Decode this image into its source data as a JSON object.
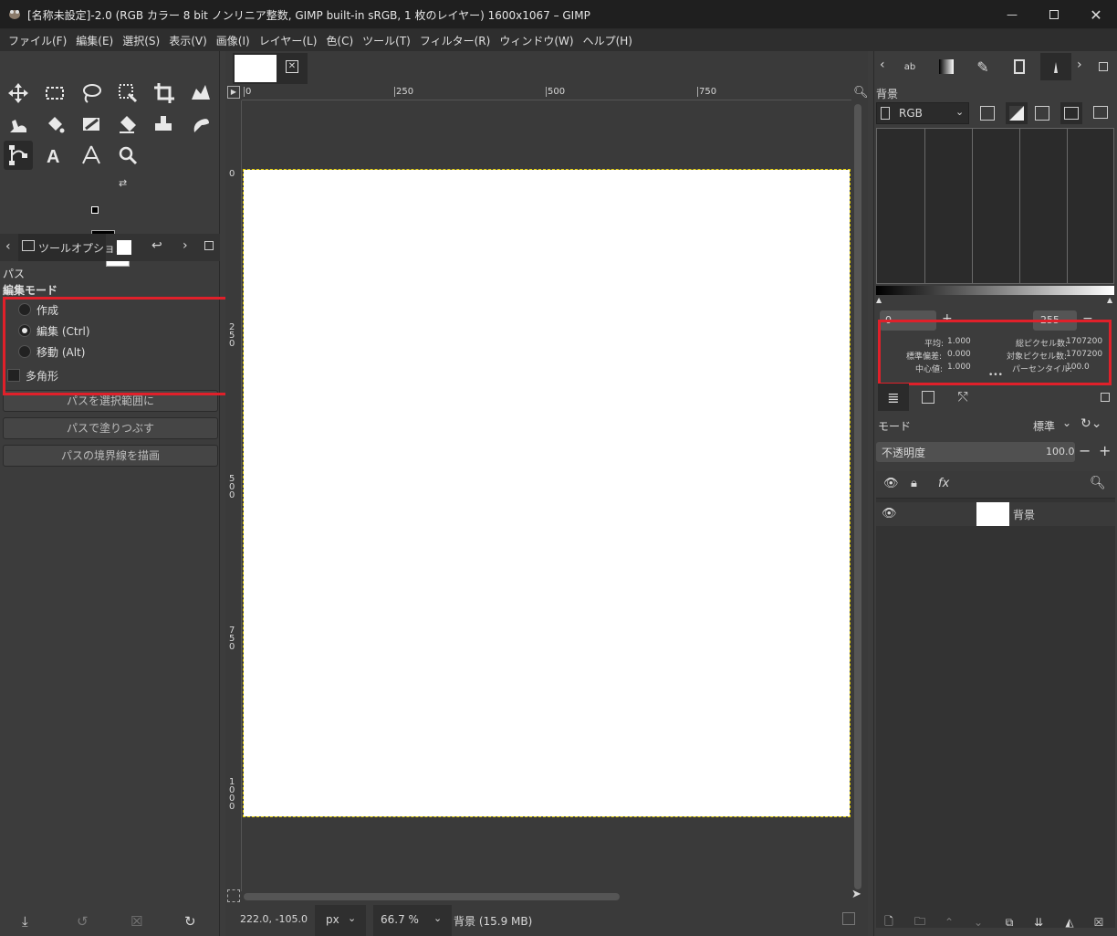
{
  "window": {
    "title": "[名称未設定]-2.0 (RGB カラー 8 bit ノンリニア整数, GIMP built-in sRGB, 1 枚のレイヤー) 1600x1067 – GIMP"
  },
  "menu": [
    "ファイル(F)",
    "編集(E)",
    "選択(S)",
    "表示(V)",
    "画像(I)",
    "レイヤー(L)",
    "色(C)",
    "ツール(T)",
    "フィルター(R)",
    "ウィンドウ(W)",
    "ヘルプ(H)"
  ],
  "tool_options": {
    "tab_label": "ツールオプション",
    "tool_name": "パス",
    "edit_mode_label": "編集モード",
    "modes": [
      "作成",
      "編集 (Ctrl)",
      "移動 (Alt)"
    ],
    "selected_mode": "編集 (Ctrl)",
    "polygon_label": "多角形",
    "buttons": [
      "パスを選択範囲に",
      "パスで塗りつぶす",
      "パスの境界線を描画"
    ]
  },
  "ruler": {
    "h_ticks": [
      "0",
      "250",
      "500",
      "750"
    ],
    "v_ticks": [
      "0",
      "2\n5\n0",
      "5\n0\n0",
      "7\n5\n0",
      "1\n0\n0\n0"
    ]
  },
  "status": {
    "coords": "222.0, -105.0",
    "unit": "px",
    "zoom": "66.7 %",
    "info": "背景 (15.9 MB)"
  },
  "histogram": {
    "layer_name": "背景",
    "channel": "RGB",
    "range_low": "0",
    "range_high": "255",
    "stats": {
      "mean_label": "平均:",
      "mean": "1.000",
      "std_label": "標準偏差:",
      "std": "0.000",
      "median_label": "中心値:",
      "median": "1.000",
      "pixels_label": "総ピクセル数:",
      "pixels": "1707200",
      "count_label": "対象ピクセル数:",
      "count": "1707200",
      "percentile_label": "パーセンタイル:",
      "percentile": "100.0"
    }
  },
  "layers": {
    "mode_label": "モード",
    "mode_value": "標準",
    "opacity_label": "不透明度",
    "opacity_value": "100.0",
    "items": [
      {
        "name": "背景"
      }
    ]
  },
  "colors": {
    "highlight": "#e0202a",
    "selection": "#e6d000"
  }
}
